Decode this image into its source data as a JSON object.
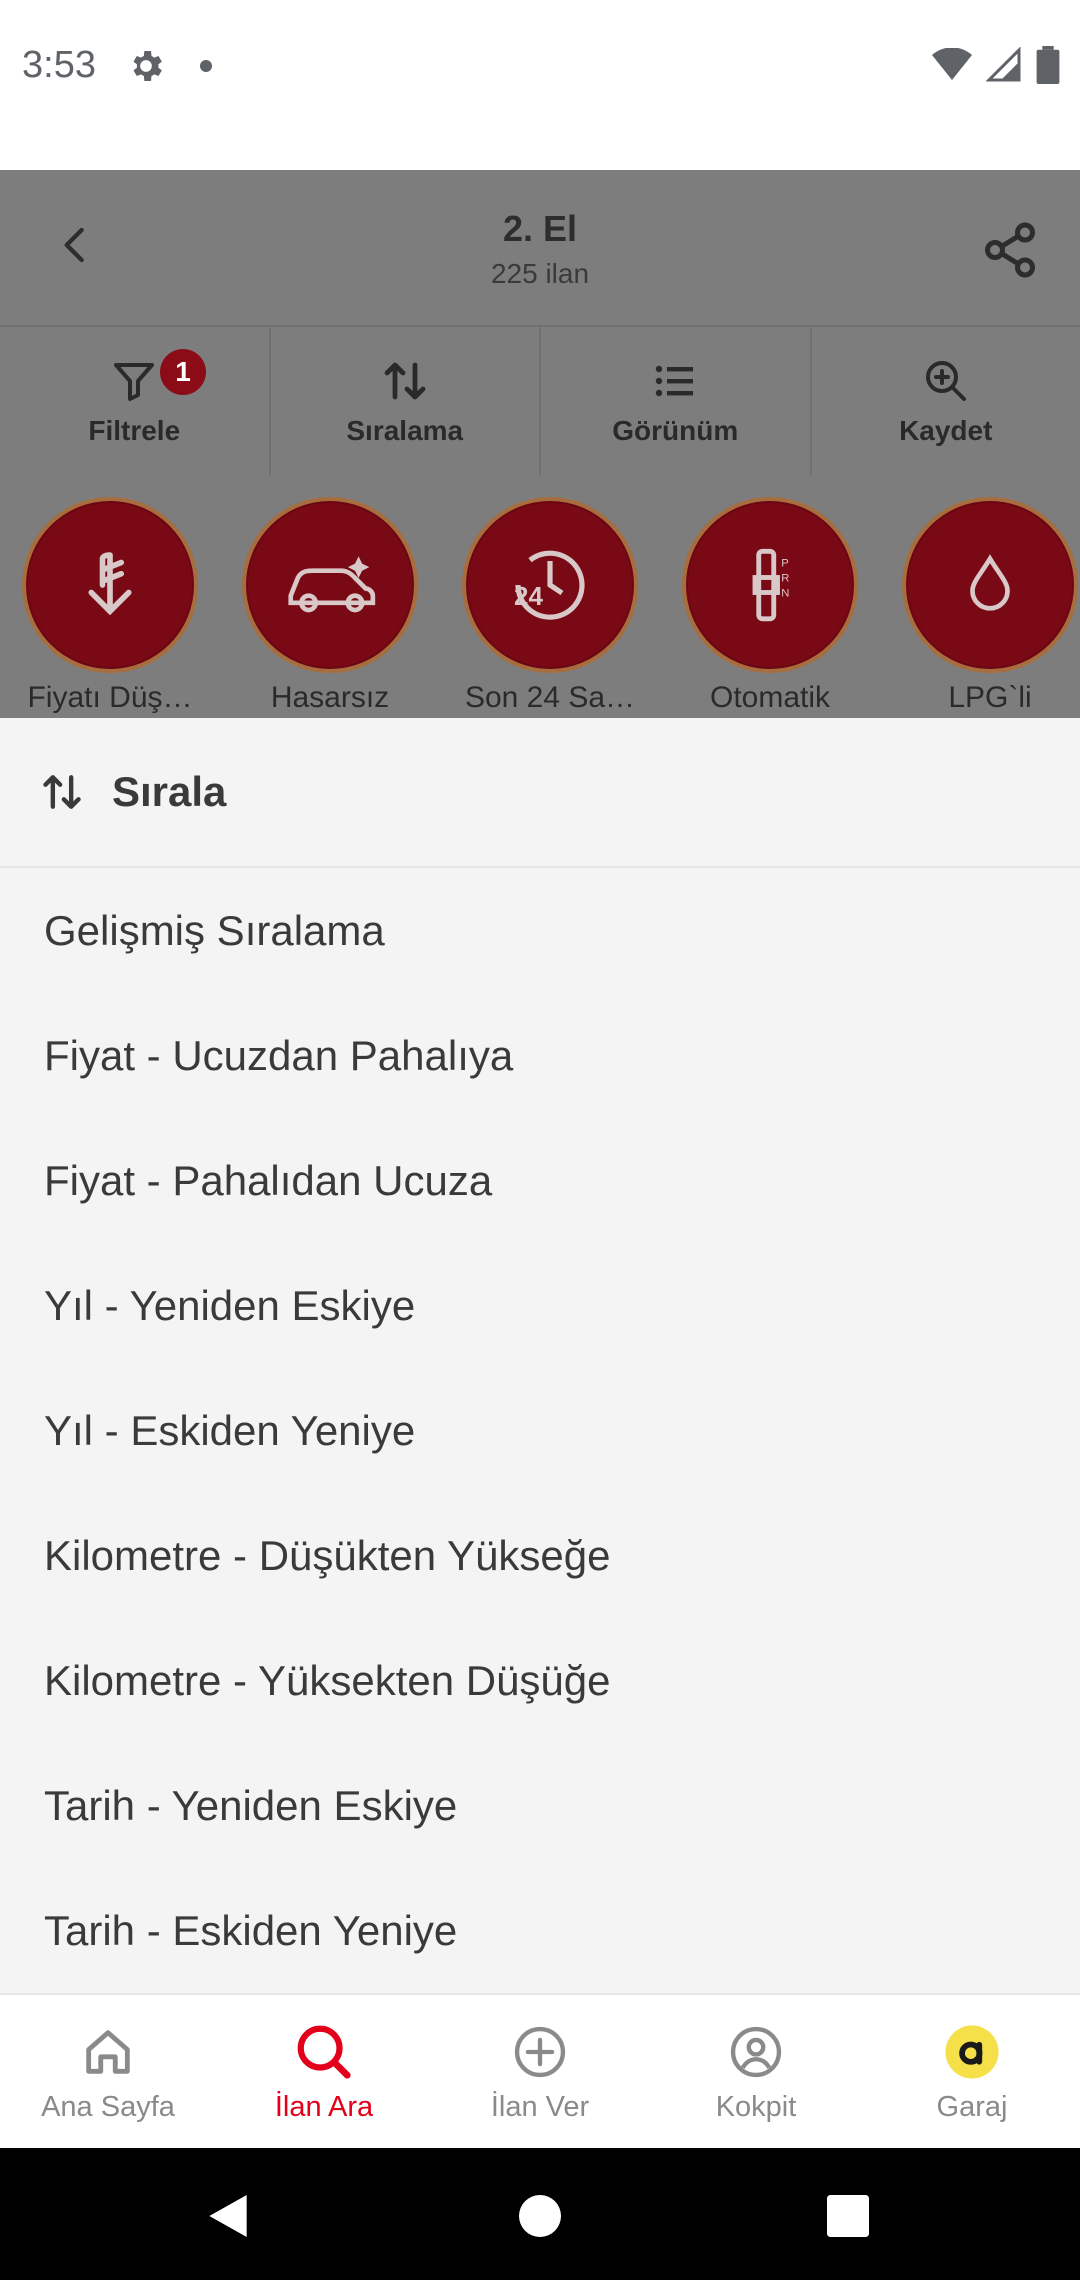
{
  "status": {
    "time": "3:53"
  },
  "header": {
    "title": "2. El",
    "subtitle": "225 ilan"
  },
  "toolbar": {
    "filter_label": "Filtrele",
    "filter_badge": "1",
    "sort_label": "Sıralama",
    "view_label": "Görünüm",
    "save_label": "Kaydet"
  },
  "chips": [
    {
      "label": "Fiyatı Düş…",
      "icon": "price-down-icon"
    },
    {
      "label": "Hasarsız",
      "icon": "car-icon"
    },
    {
      "label": "Son 24 Sa…",
      "icon": "clock-24-icon"
    },
    {
      "label": "Otomatik",
      "icon": "gear-shift-icon"
    },
    {
      "label": "LPG`li",
      "icon": "drop-icon"
    }
  ],
  "sheet": {
    "title": "Sırala",
    "options": [
      "Gelişmiş Sıralama",
      "Fiyat - Ucuzdan Pahalıya",
      "Fiyat - Pahalıdan Ucuza",
      "Yıl - Yeniden Eskiye",
      "Yıl - Eskiden Yeniye",
      "Kilometre - Düşükten Yükseğe",
      "Kilometre - Yüksekten Düşüğe",
      "Tarih - Yeniden Eskiye",
      "Tarih - Eskiden Yeniye"
    ]
  },
  "bottom_nav": [
    {
      "label": "Ana Sayfa",
      "icon": "home-icon",
      "active": false
    },
    {
      "label": "İlan Ara",
      "icon": "search-icon",
      "active": true
    },
    {
      "label": "İlan Ver",
      "icon": "add-circle-icon",
      "active": false
    },
    {
      "label": "Kokpit",
      "icon": "account-icon",
      "active": false
    },
    {
      "label": "Garaj",
      "icon": "garage-icon",
      "active": false
    }
  ],
  "colors": {
    "accent": "#e2001a",
    "chip_fill": "#7a0916",
    "overlay": "#7d7d7d",
    "garage_badge": "#f5e04a"
  }
}
